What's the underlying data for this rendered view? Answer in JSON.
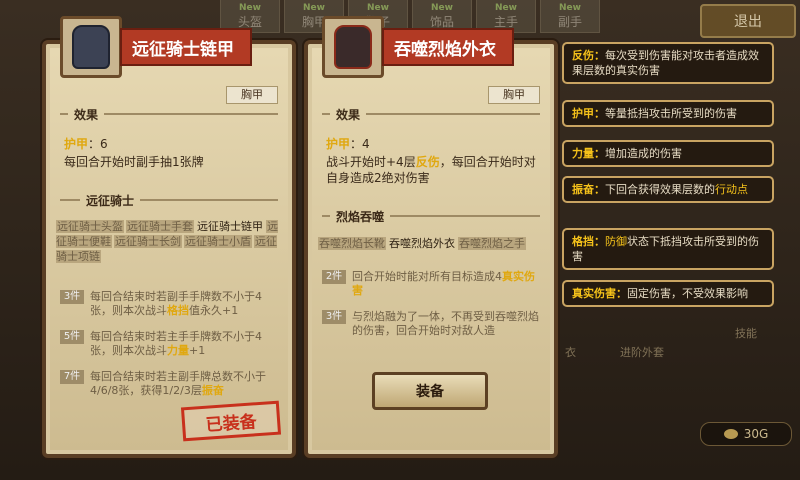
{
  "top_tabs": [
    {
      "badge": "New",
      "label": "头盔"
    },
    {
      "badge": "New",
      "label": "胸甲"
    },
    {
      "badge": "New",
      "label": "靴子"
    },
    {
      "badge": "New",
      "label": "饰品"
    },
    {
      "badge": "New",
      "label": "主手"
    },
    {
      "badge": "New",
      "label": "副手"
    }
  ],
  "exit_label": "退出",
  "card_left": {
    "title": "远征骑士链甲",
    "slot": "胸甲",
    "effect_header": "效果",
    "stat_key": "护甲",
    "stat_value": "：6",
    "effect_text": "每回合开始时副手抽1张牌",
    "set_header": "远征骑士",
    "set_items": [
      "远征骑士头盔",
      "远征骑士手套",
      "远征骑士链甲",
      "远征骑士便鞋",
      "远征骑士长剑",
      "远征骑士小盾",
      "远征骑士项链"
    ],
    "tiers": [
      {
        "badge": "3件",
        "text_a": "每回合结束时若副手手牌数不小于4张，则本次战斗",
        "hl": "格挡",
        "text_b": "值永久+1"
      },
      {
        "badge": "5件",
        "text_a": "每回合结束时若主手手牌数不小于4张，则本次战斗",
        "hl": "力量",
        "text_b": "+1"
      },
      {
        "badge": "7件",
        "text_a": "每回合结束时若主副手牌总数不小于4/6/8张，获得1/2/3层",
        "hl": "振奋",
        "text_b": ""
      }
    ],
    "equipped_stamp": "已装备"
  },
  "card_right": {
    "title": "吞噬烈焰外衣",
    "slot": "胸甲",
    "effect_header": "效果",
    "stat_key": "护甲",
    "stat_value": "：4",
    "effect_a": "战斗开始时+4层",
    "effect_hl": "反伤",
    "effect_b": "，每回合开始时对自身造成2绝对伤害",
    "set_header": "烈焰吞噬",
    "set_items": [
      "吞噬烈焰长靴",
      "吞噬烈焰外衣",
      "吞噬烈焰之手"
    ],
    "tiers": [
      {
        "badge": "2件",
        "text_a": "回合开始时能对所有目标造成4",
        "hl": "真实伤害",
        "text_b": ""
      },
      {
        "badge": "3件",
        "text_a": "与烈焰融为了一体，不再受到吞噬烈焰的伤害，回合开始时对敌人造",
        "hl": "",
        "text_b": ""
      }
    ]
  },
  "equip_button": "装备",
  "tooltips": [
    {
      "key": "反伤：",
      "text": "每次受到伤害能对攻击者造成效果层数的真实伤害"
    },
    {
      "key": "护甲：",
      "text": "等量抵挡攻击所受到的伤害"
    },
    {
      "key": "力量：",
      "text": "增加造成的伤害"
    },
    {
      "key": "振奋：",
      "text_a": "下回合获得效果层数的",
      "hl": "行动点",
      "text_b": ""
    },
    {
      "key": "格挡：",
      "hl": "防御",
      "text": "状态下抵挡攻击所受到的伤害"
    },
    {
      "key": "真实伤害：",
      "text": "固定伤害，不受效果影响"
    }
  ],
  "bg_fragments": [
    "衣",
    "进阶外套",
    "技能"
  ],
  "gold": "30G"
}
